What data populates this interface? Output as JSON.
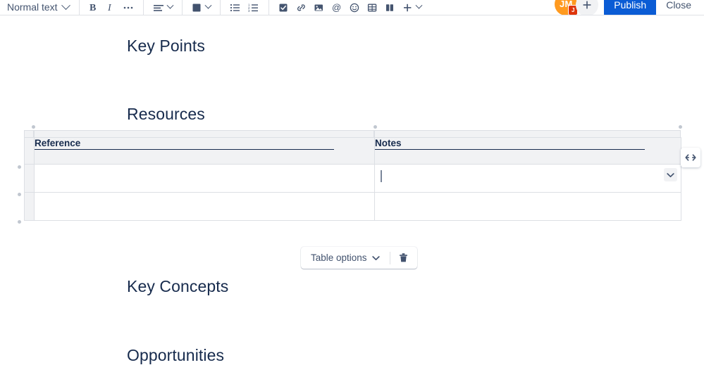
{
  "toolbar": {
    "text_style": {
      "label": "Normal text",
      "dropdown_icon": "chevron-down-icon"
    },
    "buttons": [
      {
        "name": "bold",
        "label": "B",
        "icon": "bold-icon"
      },
      {
        "name": "italic",
        "label": "I",
        "icon": "italic-icon"
      },
      {
        "name": "more-formatting",
        "label": "•••",
        "icon": "ellipsis-icon"
      },
      {
        "name": "text-align",
        "label": "",
        "icon": "text-align-icon"
      },
      {
        "name": "text-color",
        "label": "",
        "icon": "color-swatch-icon"
      },
      {
        "name": "bullet-list",
        "label": "",
        "icon": "bullet-list-icon"
      },
      {
        "name": "numbered-list",
        "label": "",
        "icon": "numbered-list-icon"
      },
      {
        "name": "action-item",
        "label": "",
        "icon": "checkbox-icon"
      },
      {
        "name": "link",
        "label": "",
        "icon": "link-icon"
      },
      {
        "name": "image",
        "label": "",
        "icon": "image-icon"
      },
      {
        "name": "mention",
        "label": "",
        "icon": "mention-at-icon"
      },
      {
        "name": "emoji",
        "label": "",
        "icon": "emoji-smiley-icon"
      },
      {
        "name": "table",
        "label": "",
        "icon": "table-grid-icon"
      },
      {
        "name": "layouts",
        "label": "",
        "icon": "layout-columns-icon"
      },
      {
        "name": "insert-more",
        "label": "",
        "icon": "plus-icon"
      }
    ],
    "color_swatch_hex": "#42526E",
    "avatar": {
      "initials": "JM",
      "badge": "J",
      "bg_hex": "#FF9A1F",
      "badge_hex": "#DE350B"
    },
    "add_collaborator_label": "+",
    "publish_label": "Publish",
    "publish_bg_hex": "#0B5CD5",
    "close_label": "Close"
  },
  "document": {
    "headings": {
      "key_points": "Key Points",
      "resources": "Resources",
      "key_concepts": "Key Concepts",
      "opportunities": "Opportunities"
    },
    "table": {
      "columns": [
        "Reference",
        "Notes"
      ],
      "rows": [
        [
          "",
          ""
        ],
        [
          "",
          ""
        ]
      ],
      "active_cell": {
        "row": 0,
        "col": 1
      },
      "cell_options_icon": "chevron-down-icon",
      "expand_icon": "horizontal-resize-icon"
    }
  },
  "table_toolbar": {
    "options_label": "Table options",
    "options_icon": "chevron-down-icon",
    "delete_icon": "trash-icon"
  }
}
